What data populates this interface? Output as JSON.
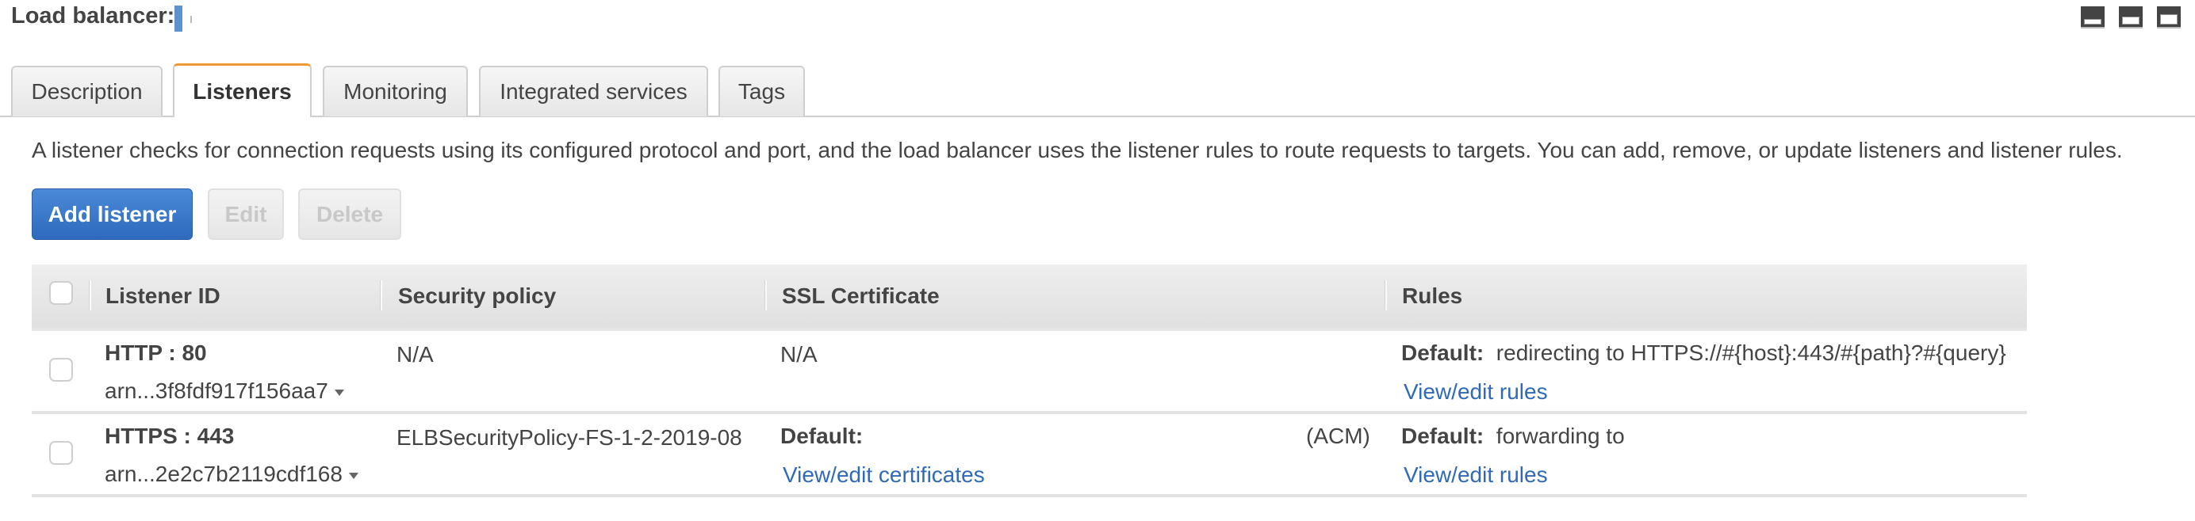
{
  "header": {
    "title_label": "Load balancer:",
    "title_value": "",
    "layout_icons": [
      "panel-bottom-small-icon",
      "panel-bottom-medium-icon",
      "panel-bottom-large-icon"
    ]
  },
  "tabs": [
    {
      "label": "Description",
      "active": false
    },
    {
      "label": "Listeners",
      "active": true
    },
    {
      "label": "Monitoring",
      "active": false
    },
    {
      "label": "Integrated services",
      "active": false
    },
    {
      "label": "Tags",
      "active": false
    }
  ],
  "listeners": {
    "description": "A listener checks for connection requests using its configured protocol and port, and the load balancer uses the listener rules to route requests to targets. You can add, remove, or update listeners and listener rules.",
    "buttons": {
      "add": "Add listener",
      "edit": "Edit",
      "delete": "Delete"
    },
    "columns": [
      "Listener ID",
      "Security policy",
      "SSL Certificate",
      "Rules"
    ],
    "rows": [
      {
        "protocol_port": "HTTP : 80",
        "arn": "arn...3f8fdf917f156aa7",
        "security_policy": "N/A",
        "ssl_certificate": "N/A",
        "ssl_label": "",
        "ssl_suffix": "",
        "ssl_link": "",
        "rules_label": "Default:",
        "rules_value": "redirecting to HTTPS://#{host}:443/#{path}?#{query}",
        "rules_link": "View/edit rules"
      },
      {
        "protocol_port": "HTTPS : 443",
        "arn": "arn...2e2c7b2119cdf168",
        "security_policy": "ELBSecurityPolicy-FS-1-2-2019-08",
        "ssl_certificate": "",
        "ssl_label": "Default:",
        "ssl_suffix": "(ACM)",
        "ssl_link": "View/edit certificates",
        "rules_label": "Default:",
        "rules_value": "forwarding to",
        "rules_link": "View/edit rules"
      }
    ]
  },
  "colors": {
    "accent_tab": "#f09a36",
    "primary_button": "#2e69bd",
    "link": "#2e6ab8"
  }
}
